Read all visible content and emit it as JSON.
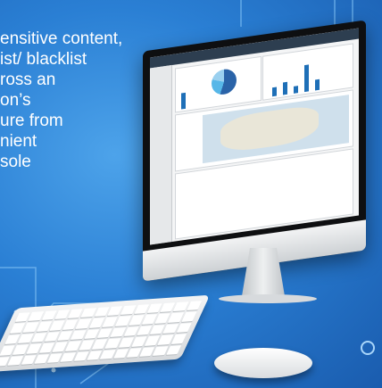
{
  "headline_lines": [
    "ensitive content,",
    "ist/ blacklist",
    "ross an",
    "on’s",
    "ure from",
    "nient",
    "sole"
  ],
  "colors": {
    "background": "#2a7fd4",
    "text": "#ffffff",
    "accent": "#1e6fb7"
  }
}
